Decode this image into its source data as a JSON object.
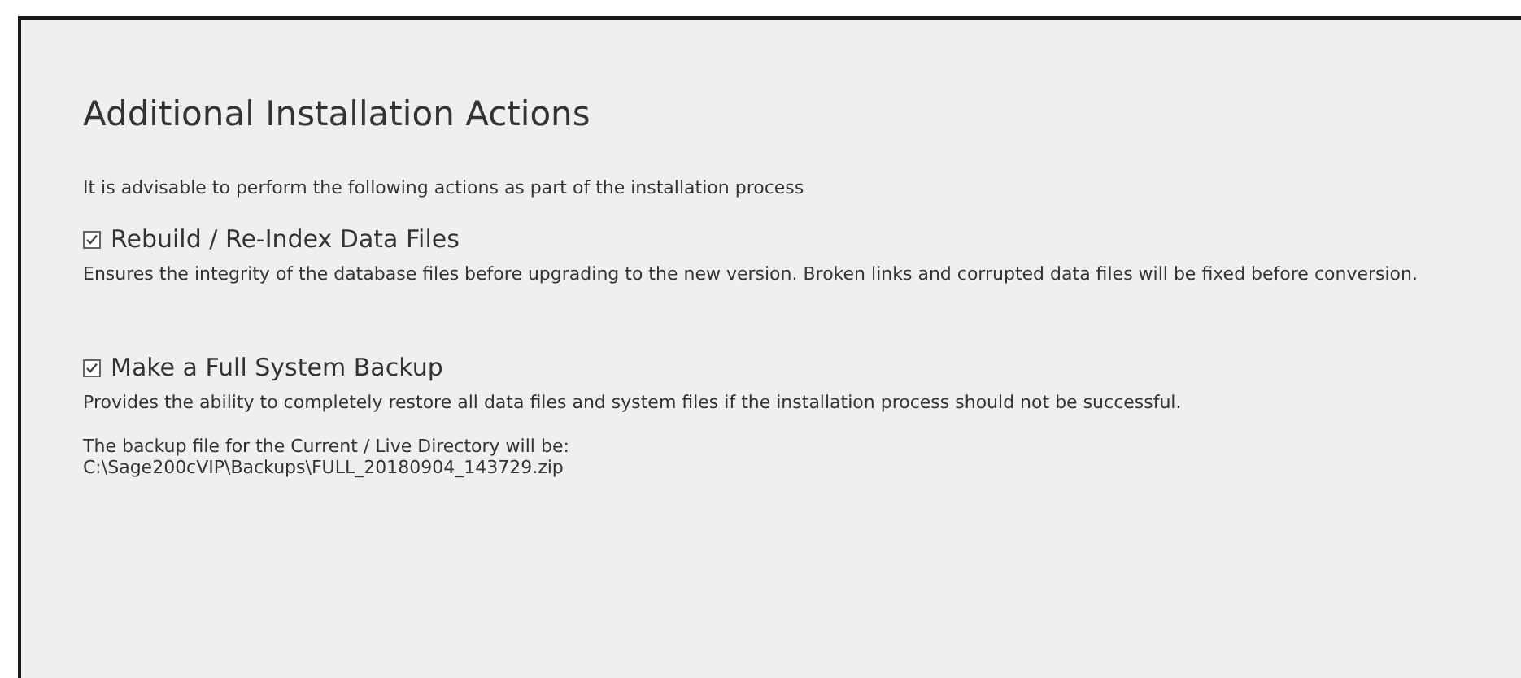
{
  "title": "Additional Installation Actions",
  "intro": "It is advisable to perform the following actions as part of the installation process",
  "actions": [
    {
      "label": "Rebuild / Re-Index Data Files",
      "checked": true,
      "description": "Ensures the integrity of the database files before upgrading to the new version. Broken links and corrupted data files will be fixed before conversion."
    },
    {
      "label": "Make a Full System Backup",
      "checked": true,
      "description": "Provides the ability to completely restore all data files and system files if the installation process should not be successful.",
      "note_lines": [
        "The backup file for the Current / Live Directory will be:",
        "C:\\Sage200cVIP\\Backups\\FULL_20180904_143729.zip"
      ]
    }
  ]
}
